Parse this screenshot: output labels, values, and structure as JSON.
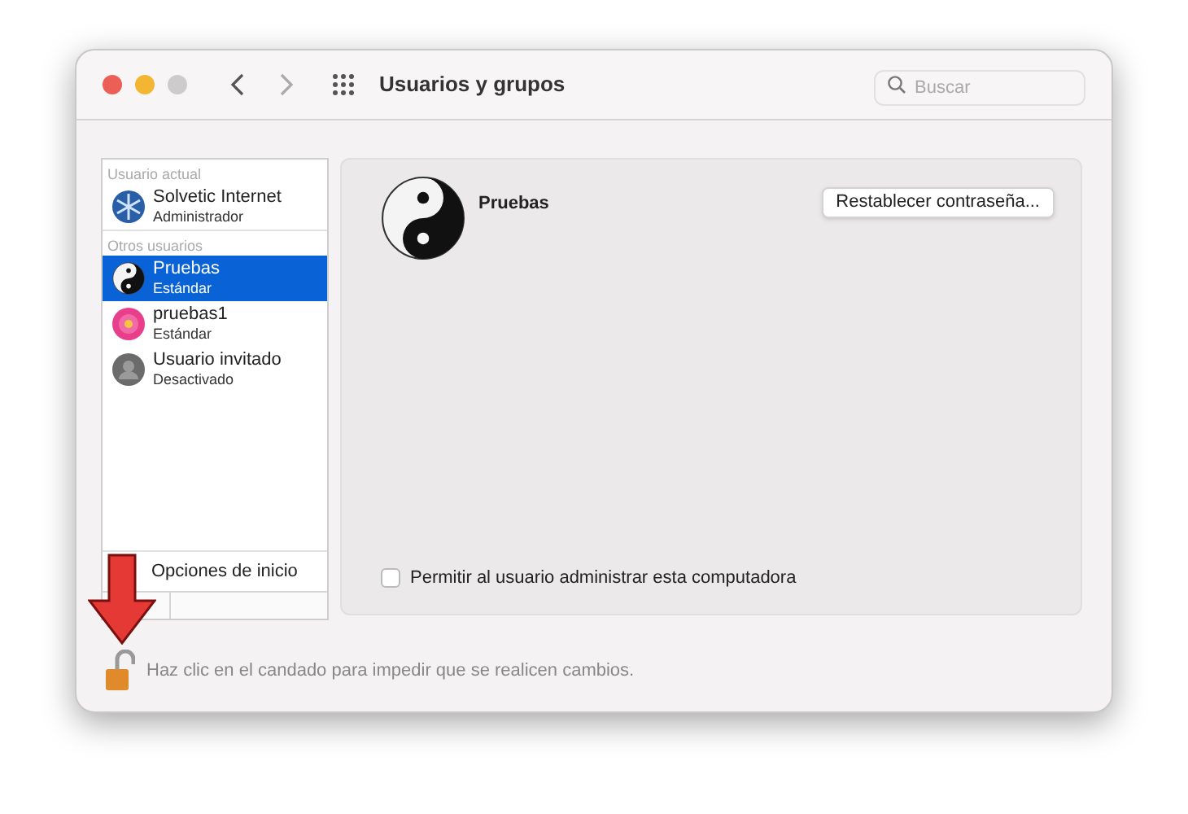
{
  "window": {
    "title": "Usuarios y grupos"
  },
  "search": {
    "placeholder": "Buscar"
  },
  "sidebar": {
    "groups": [
      {
        "header": "Usuario actual",
        "users": [
          {
            "name": "Solvetic Internet",
            "role": "Administrador",
            "selected": false
          }
        ]
      },
      {
        "header": "Otros usuarios",
        "users": [
          {
            "name": "Pruebas",
            "role": "Estándar",
            "selected": true
          },
          {
            "name": "pruebas1",
            "role": "Estándar",
            "selected": false
          },
          {
            "name": "Usuario invitado",
            "role": "Desactivado",
            "selected": false
          }
        ]
      }
    ],
    "login_options": "Opciones de inicio"
  },
  "detail": {
    "name": "Pruebas",
    "reset_button": "Restablecer contraseña...",
    "admin_checkbox": {
      "label": "Permitir al usuario administrar esta computadora",
      "checked": false
    }
  },
  "lock": {
    "locked": false,
    "message": "Haz clic en el candado para impedir que se realicen cambios."
  }
}
